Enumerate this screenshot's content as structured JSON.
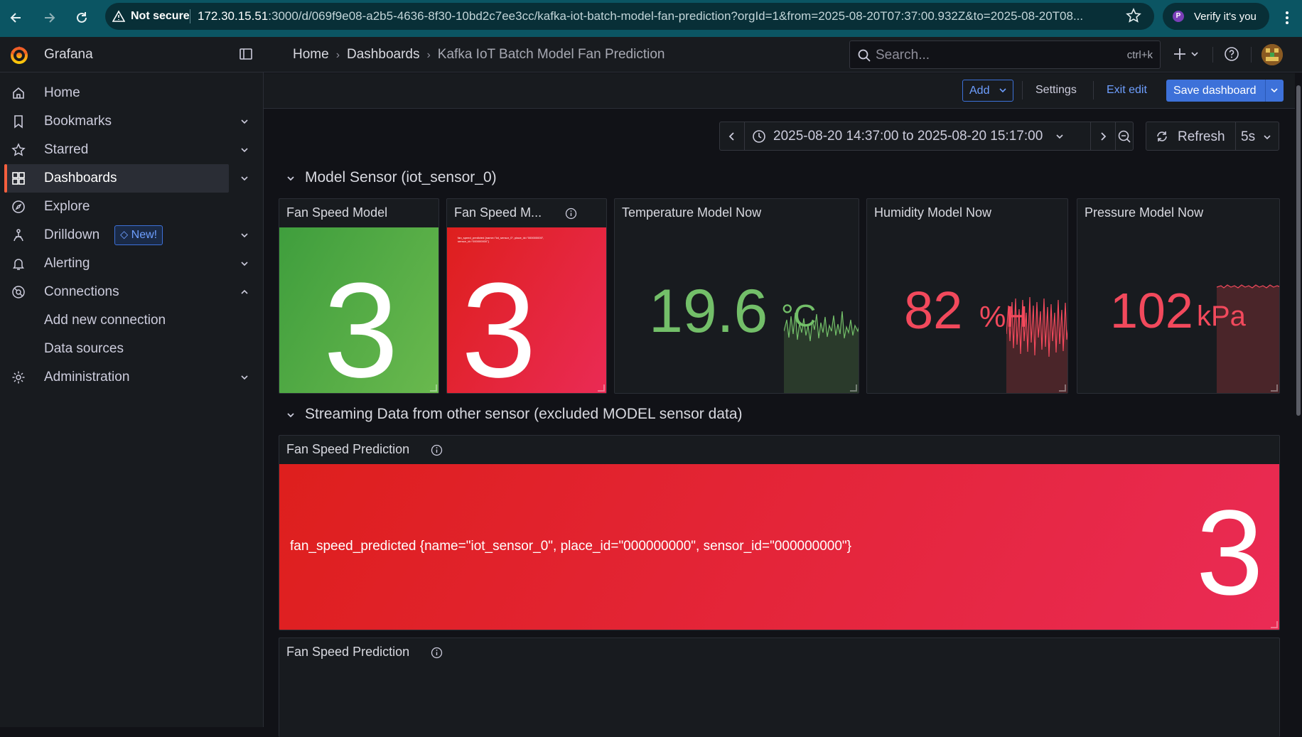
{
  "browser": {
    "security_label": "Not secure",
    "url_host": "172.30.15.51",
    "url_rest": ":3000/d/069f9e08-a2b5-4636-8f30-10bd2c7ee3cc/kafka-iot-batch-model-fan-prediction?orgId=1&from=2025-08-20T07:37:00.932Z&to=2025-08-20T08...",
    "profile_initial": "P",
    "profile_label": "Verify it's you"
  },
  "header": {
    "app_name": "Grafana",
    "breadcrumbs": [
      "Home",
      "Dashboards",
      "Kafka IoT Batch Model Fan Prediction"
    ],
    "search_placeholder": "Search...",
    "search_shortcut": "ctrl+k"
  },
  "sidebar": {
    "items": [
      {
        "label": "Home",
        "icon": "home-icon"
      },
      {
        "label": "Bookmarks",
        "icon": "bookmark-icon"
      },
      {
        "label": "Starred",
        "icon": "star-icon"
      },
      {
        "label": "Dashboards",
        "icon": "dashboards-icon",
        "active": true
      },
      {
        "label": "Explore",
        "icon": "compass-icon"
      },
      {
        "label": "Drilldown",
        "icon": "drilldown-icon",
        "badge": "New!"
      },
      {
        "label": "Alerting",
        "icon": "bell-icon"
      },
      {
        "label": "Connections",
        "icon": "connections-icon"
      },
      {
        "label": "Add new connection"
      },
      {
        "label": "Data sources"
      },
      {
        "label": "Administration",
        "icon": "gear-icon"
      }
    ]
  },
  "toolbar": {
    "add_label": "Add",
    "settings_label": "Settings",
    "exit_label": "Exit edit",
    "save_label": "Save dashboard"
  },
  "time": {
    "range": "2025-08-20 14:37:00 to 2025-08-20 15:17:00",
    "refresh_label": "Refresh",
    "interval": "5s"
  },
  "rows": [
    {
      "title": "Model Sensor (iot_sensor_0)"
    },
    {
      "title": "Streaming Data from other sensor (excluded MODEL sensor data)"
    }
  ],
  "panels": {
    "fan_model": {
      "title": "Fan Speed Model",
      "value": "3",
      "color": "#56a64b"
    },
    "fan_model_2": {
      "title": "Fan Speed M...",
      "value": "3",
      "color": "#e02f44",
      "caption": "fan_speed_predicted {name=\"iot_sensor_0\", place_id=\"000000000\", sensor_id=\"000000000\"}"
    },
    "temperature": {
      "title": "Temperature Model Now",
      "value": "19.6",
      "unit": "°C",
      "color": "#73bf69"
    },
    "humidity": {
      "title": "Humidity Model Now",
      "value": "82",
      "unit": "%H",
      "color": "#f2495c"
    },
    "pressure": {
      "title": "Pressure Model Now",
      "value": "102",
      "unit": "kPa",
      "color": "#f2495c"
    },
    "fan_pred": {
      "title": "Fan Speed Prediction",
      "series_label": "fan_speed_predicted {name=\"iot_sensor_0\", place_id=\"000000000\", sensor_id=\"000000000\"}",
      "value": "3",
      "color": "#e02f44"
    },
    "fan_pred_2": {
      "title": "Fan Speed Prediction"
    }
  }
}
